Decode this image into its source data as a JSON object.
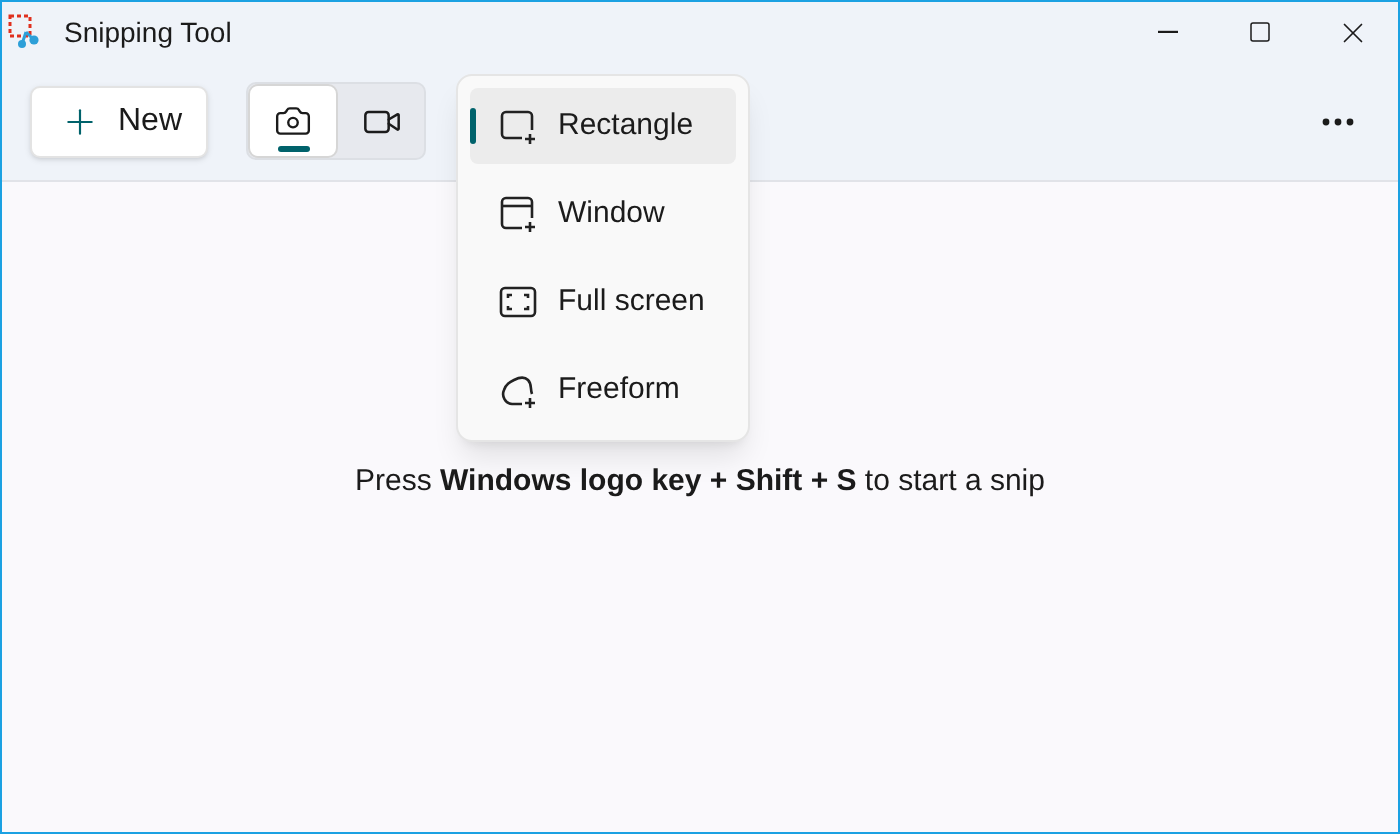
{
  "window": {
    "title": "Snipping Tool"
  },
  "toolbar": {
    "new_button": "New",
    "modes": [
      {
        "kind": "snip",
        "selected": true
      },
      {
        "kind": "record",
        "selected": false
      }
    ]
  },
  "snip_menu": [
    {
      "kind": "rectangle",
      "label": "Rectangle",
      "selected": true
    },
    {
      "kind": "window",
      "label": "Window",
      "selected": false
    },
    {
      "kind": "fullscreen",
      "label": "Full screen",
      "selected": false
    },
    {
      "kind": "freeform",
      "label": "Freeform",
      "selected": false
    }
  ],
  "hint": "Press **Windows logo key + Shift + S** to start a snip"
}
